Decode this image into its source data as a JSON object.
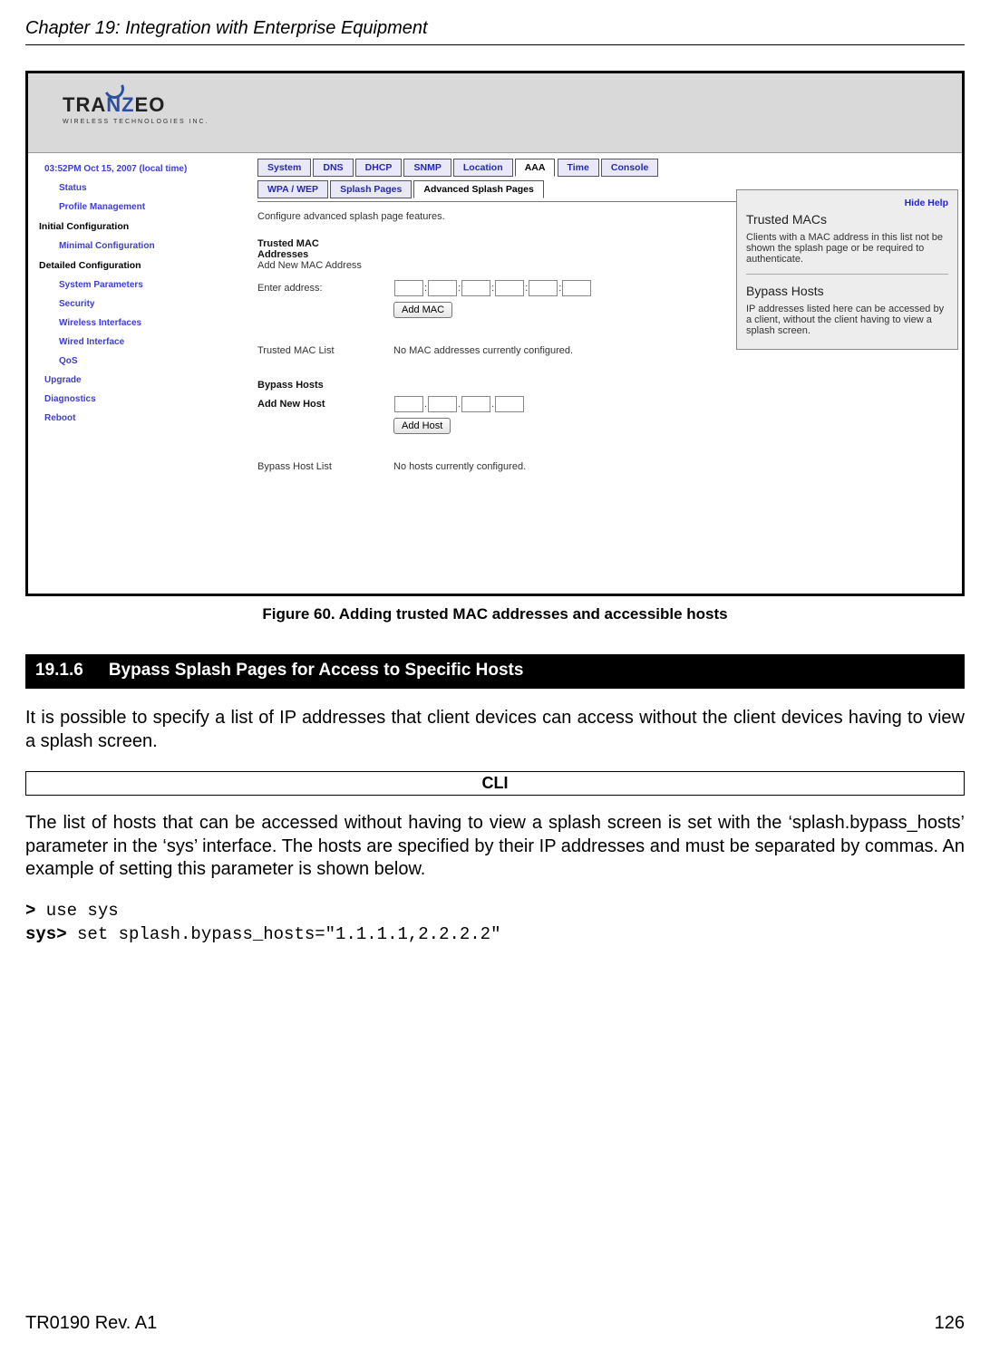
{
  "doc": {
    "chapter_title": "Chapter 19: Integration with Enterprise Equipment",
    "footer_left": "TR0190 Rev. A1",
    "footer_right": "126"
  },
  "screenshot": {
    "logo_main_left": "TRA",
    "logo_main_mid": "NZ",
    "logo_main_right": "EO",
    "logo_sub": "WIRELESS  TECHNOLOGIES INC.",
    "sidebar": {
      "time": "03:52PM Oct 15, 2007 (local time)",
      "items_top": [
        "Status",
        "Profile Management"
      ],
      "cat1": "Initial Configuration",
      "cat1_items": [
        "Minimal Configuration"
      ],
      "cat2": "Detailed Configuration",
      "cat2_items": [
        "System Parameters",
        "Security",
        "Wireless Interfaces",
        "Wired Interface",
        "QoS"
      ],
      "items_bottom": [
        "Upgrade",
        "Diagnostics",
        "Reboot"
      ]
    },
    "tabs_row1": [
      "System",
      "DNS",
      "DHCP",
      "SNMP",
      "Location",
      "AAA",
      "Time",
      "Console"
    ],
    "tabs_row1_active": "AAA",
    "tabs_row2": [
      "WPA / WEP",
      "Splash Pages",
      "Advanced Splash Pages"
    ],
    "tabs_row2_active": "Advanced Splash Pages",
    "desc": "Configure advanced splash page features.",
    "mac": {
      "h1": "Trusted MAC",
      "h2": "Addresses",
      "sub": "Add New MAC Address",
      "enter": "Enter address:",
      "btn": "Add MAC",
      "list_label": "Trusted MAC List",
      "list_val": "No MAC addresses currently configured."
    },
    "host": {
      "h1": "Bypass Hosts",
      "sub": "Add New Host",
      "btn": "Add Host",
      "list_label": "Bypass Host List",
      "list_val": "No hosts currently configured."
    },
    "help": {
      "hide": "Hide Help",
      "t1": "Trusted MACs",
      "p1": "Clients with a MAC address in this list not be shown the splash page or be required to authenticate.",
      "t2": "Bypass Hosts",
      "p2": "IP addresses listed here can be accessed by a client, without the client having to view a splash screen."
    }
  },
  "figure_caption": "Figure 60. Adding trusted MAC addresses and accessible hosts",
  "section": {
    "num": "19.1.6",
    "title": "Bypass Splash Pages for Access to Specific Hosts"
  },
  "para1": "It is possible to specify a list of IP addresses that client devices can access without the client devices having to view a splash screen.",
  "cli_label": "CLI",
  "para2": "The list of hosts that can be accessed without having to view a splash screen is set with the ‘splash.bypass_hosts’ parameter in the ‘sys’ interface. The hosts are specified by their IP addresses and must be separated by commas. An example of setting this parameter is shown below.",
  "cli": {
    "p1": ">",
    "l1": " use sys",
    "p2": "sys>",
    "l2": " set splash.bypass_hosts=\"1.1.1.1,2.2.2.2\""
  }
}
